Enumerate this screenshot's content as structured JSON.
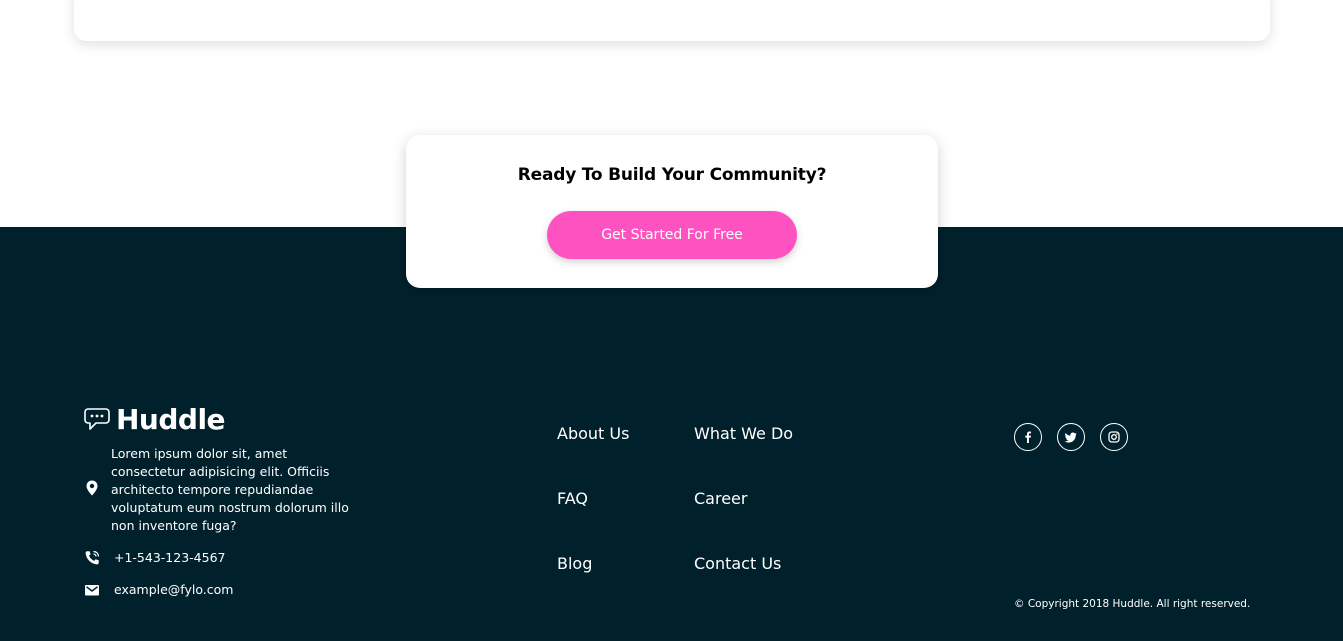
{
  "cta": {
    "title": "Ready To Build Your Community?",
    "button_label": "Get Started For Free"
  },
  "brand": {
    "name": "Huddle"
  },
  "contact": {
    "address": "Lorem ipsum dolor sit, amet consectetur adipisicing elit. Officiis architecto tempore repudiandae voluptatum eum nostrum dolorum illo non inventore fuga?",
    "phone": "+1-543-123-4567",
    "email": "example@fylo.com"
  },
  "nav": {
    "about": "About Us",
    "what_we_do": "What We Do",
    "faq": "FAQ",
    "career": "Career",
    "blog": "Blog",
    "contact": "Contact Us"
  },
  "social": [
    "facebook-icon",
    "twitter-icon",
    "instagram-icon"
  ],
  "copyright": "© Copyright 2018 Huddle. All right reserved.",
  "colors": {
    "footer_bg": "#00212c",
    "accent_pink": "#ff52c1",
    "page_bg": "#ffffff"
  }
}
